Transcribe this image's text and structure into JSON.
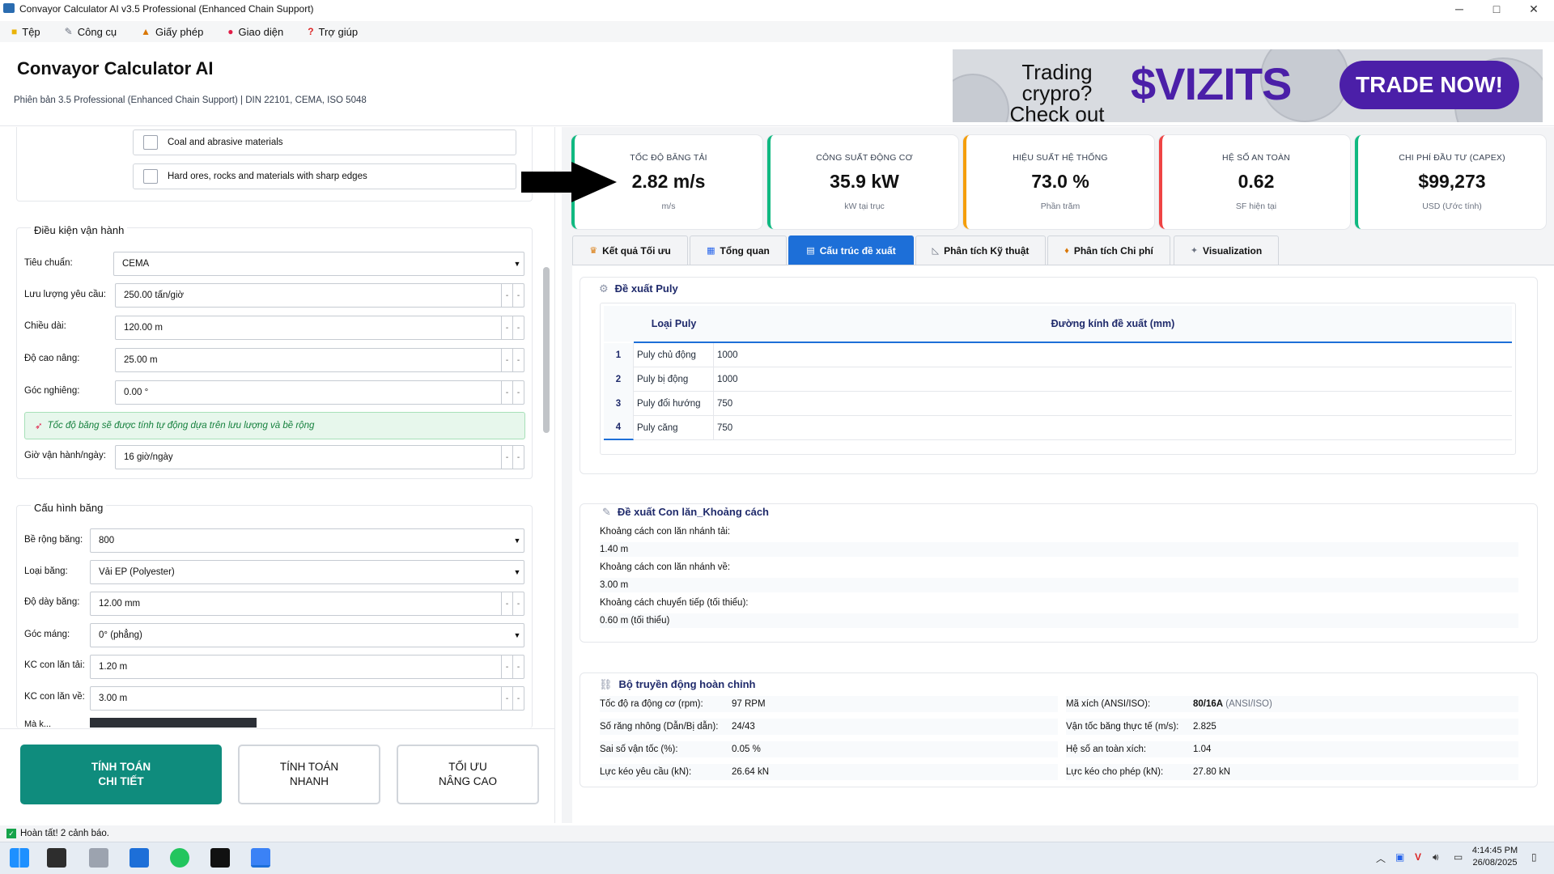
{
  "window": {
    "title": "Convayor Calculator AI v3.5 Professional (Enhanced Chain Support)",
    "minimize": "─",
    "maximize": "□",
    "close": "✕"
  },
  "menu": [
    {
      "label": "Tệp",
      "icon": "folder-icon"
    },
    {
      "label": "Công cụ",
      "icon": "wrench-icon"
    },
    {
      "label": "Giấy phép",
      "icon": "lock-icon"
    },
    {
      "label": "Giao diện",
      "icon": "palette-icon"
    },
    {
      "label": "Trợ giúp",
      "icon": "help-icon"
    }
  ],
  "header": {
    "title": "Convayor Calculator AI",
    "subtitle": "Phiên bản 3.5 Professional (Enhanced Chain Support) | DIN 22101, CEMA, ISO 5048"
  },
  "ad": {
    "line1": "Trading crypro?",
    "line2": "Check out",
    "brand": "$VIZITS",
    "cta": "TRADE NOW!"
  },
  "materials": [
    {
      "label": "Coal and abrasive materials",
      "checked": false
    },
    {
      "label": "Hard ores, rocks and materials with sharp edges",
      "checked": false
    }
  ],
  "operating": {
    "title": "Điều kiện vận hành",
    "fields": [
      {
        "label": "Tiêu chuẩn:",
        "value": "CEMA",
        "kind": "dropdown"
      },
      {
        "label": "Lưu lượng yêu cầu:",
        "value": "250.00 tấn/giờ",
        "kind": "spin"
      },
      {
        "label": "Chiều dài:",
        "value": "120.00 m",
        "kind": "spin"
      },
      {
        "label": "Độ cao nâng:",
        "value": "25.00 m",
        "kind": "spin"
      },
      {
        "label": "Góc nghiêng:",
        "value": "0.00 °",
        "kind": "spin"
      }
    ],
    "note": "Tốc độ băng sẽ được tính tự động dựa trên lưu lượng và bề rộng",
    "hours": {
      "label": "Giờ vận hành/ngày:",
      "value": "16 giờ/ngày"
    }
  },
  "belt": {
    "title": "Cấu hình băng",
    "fields": [
      {
        "label": "Bề rộng băng:",
        "value": "800",
        "kind": "dropdown"
      },
      {
        "label": "Loại băng:",
        "value": "Vải EP (Polyester)",
        "kind": "dropdown"
      },
      {
        "label": "Độ dày băng:",
        "value": "12.00 mm",
        "kind": "spin"
      },
      {
        "label": "Góc máng:",
        "value": "0° (phẳng)",
        "kind": "dropdown"
      },
      {
        "label": "KC con lăn tải:",
        "value": "1.20 m",
        "kind": "spin"
      },
      {
        "label": "KC con lăn về:",
        "value": "3.00 m",
        "kind": "spin"
      }
    ],
    "cut_label": "Mà k..."
  },
  "buttons": {
    "detail": "TÍNH TOÁN\nCHI TIẾT",
    "quick": "TÍNH TOÁN\nNHANH",
    "advanced": "TỐI ƯU\nNÂNG CAO"
  },
  "status": {
    "text": "Hoàn tất! 2 cảnh báo."
  },
  "metrics": [
    {
      "key": "Tốc độ băng tải",
      "value": "2.82 m/s",
      "unit": "m/s",
      "color": "#10b981"
    },
    {
      "key": "Công suất động cơ",
      "value": "35.9 kW",
      "unit": "kW tại trục",
      "color": "#10b981"
    },
    {
      "key": "Hiệu suất hệ thống",
      "value": "73.0 %",
      "unit": "Phần trăm",
      "color": "#f59e0b"
    },
    {
      "key": "Hệ số an toàn",
      "value": "0.62",
      "unit": "SF hiện tại",
      "color": "#ef4444"
    },
    {
      "key": "Chi phí đầu tư (CAPEX)",
      "value": "$99,273",
      "unit": "USD (Ước tính)",
      "color": "#10b981"
    }
  ],
  "tabs": [
    {
      "label": "Kết quả Tối ưu",
      "icon": "trophy-icon"
    },
    {
      "label": "Tổng quan",
      "icon": "chart-icon"
    },
    {
      "label": "Cấu trúc đề xuất",
      "icon": "blocks-icon",
      "active": true
    },
    {
      "label": "Phân tích Kỹ thuật",
      "icon": "ruler-icon"
    },
    {
      "label": "Phân tích Chi phí",
      "icon": "moneybag-icon"
    },
    {
      "label": "Visualization",
      "icon": "visual-icon"
    }
  ],
  "pulley": {
    "title": "Đề xuất Puly",
    "headers": [
      "Loại Puly",
      "Đường kính đề xuất (mm)"
    ],
    "rows": [
      {
        "n": "1",
        "type": "Puly chủ động",
        "dia": "1000"
      },
      {
        "n": "2",
        "type": "Puly bị động",
        "dia": "1000"
      },
      {
        "n": "3",
        "type": "Puly đổi hướng",
        "dia": "750"
      },
      {
        "n": "4",
        "type": "Puly căng",
        "dia": "750"
      }
    ]
  },
  "roller": {
    "title": "Đề xuất Con lăn_Khoảng cách",
    "items": [
      {
        "label": "Khoảng cách con lăn nhánh tải:",
        "value": "1.40 m"
      },
      {
        "label": "Khoảng cách con lăn nhánh về:",
        "value": "3.00 m"
      },
      {
        "label": "Khoảng cách chuyển tiếp (tối thiểu):",
        "value": "0.60 m (tối thiểu)"
      }
    ]
  },
  "drive": {
    "title": "Bộ truyền động hoàn chỉnh",
    "left": [
      {
        "label": "Tốc độ ra động cơ (rpm):",
        "value": "97 RPM"
      },
      {
        "label": "Số răng nhông (Dẫn/Bị dẫn):",
        "value": "24/43"
      },
      {
        "label": "Sai số vận tốc (%):",
        "value": "0.05 %"
      },
      {
        "label": "Lực kéo yêu cầu (kN):",
        "value": "26.64 kN"
      }
    ],
    "right": [
      {
        "label": "Mã xích (ANSI/ISO):",
        "value": "80/16A",
        "suffix": "(ANSI/ISO)"
      },
      {
        "label": "Vận tốc băng thực tế (m/s):",
        "value": "2.825"
      },
      {
        "label": "Hệ số an toàn xích:",
        "value": "1.04"
      },
      {
        "label": "Lực kéo cho phép (kN):",
        "value": "27.80 kN"
      }
    ]
  },
  "taskbar": {
    "time": "4:14:45 PM",
    "date": "26/08/2025"
  }
}
